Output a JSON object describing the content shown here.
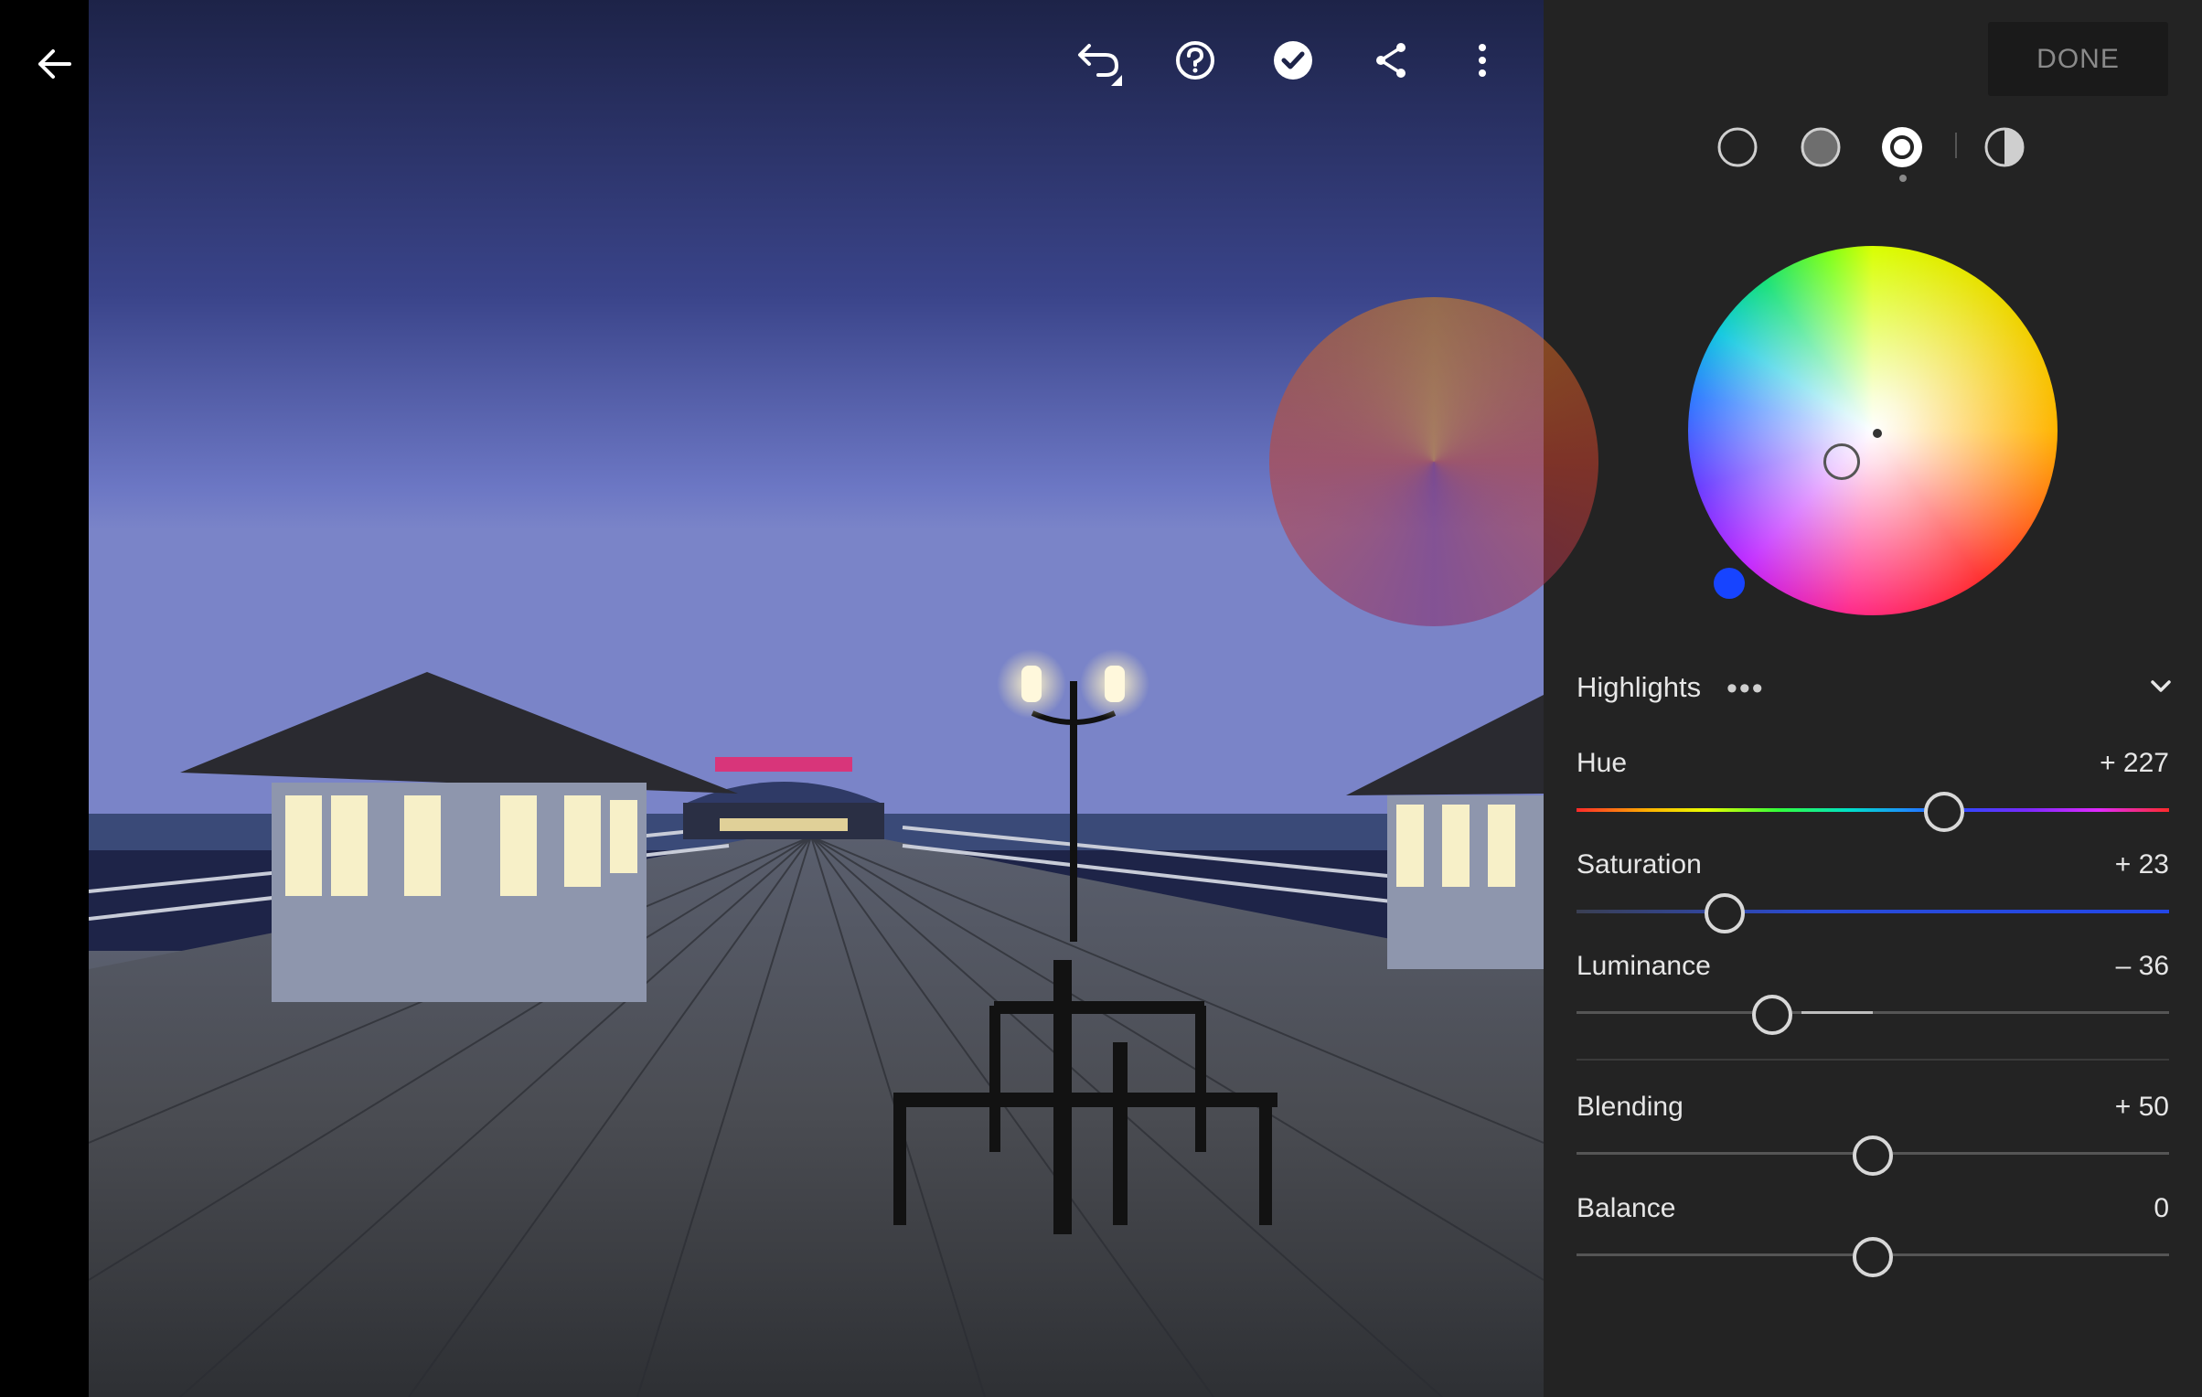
{
  "left": {
    "back_icon": "arrow-left-icon"
  },
  "toolbar": {
    "icons": [
      "undo-icon",
      "help-icon",
      "checkmark-icon",
      "share-icon",
      "more-vertical-icon"
    ]
  },
  "panel": {
    "done_label": "DONE",
    "modes": [
      "shadows-mode",
      "midtones-mode",
      "highlights-mode",
      "global-mode"
    ],
    "active_mode": "highlights-mode",
    "section": {
      "label": "Highlights",
      "more": "•••"
    },
    "sliders": [
      {
        "label": "Hue",
        "value": "+ 227",
        "fraction": 0.62
      },
      {
        "label": "Saturation",
        "value": "+ 23",
        "fraction": 0.25
      },
      {
        "label": "Luminance",
        "value": "– 36",
        "fraction": 0.33
      },
      {
        "label": "Blending",
        "value": "+ 50",
        "fraction": 0.5
      },
      {
        "label": "Balance",
        "value": "0",
        "fraction": 0.5
      }
    ],
    "colors": {
      "panel_bg": "#232323",
      "saturation_track": "#2a4bd6",
      "selected_swatch": "#1744ff"
    }
  }
}
